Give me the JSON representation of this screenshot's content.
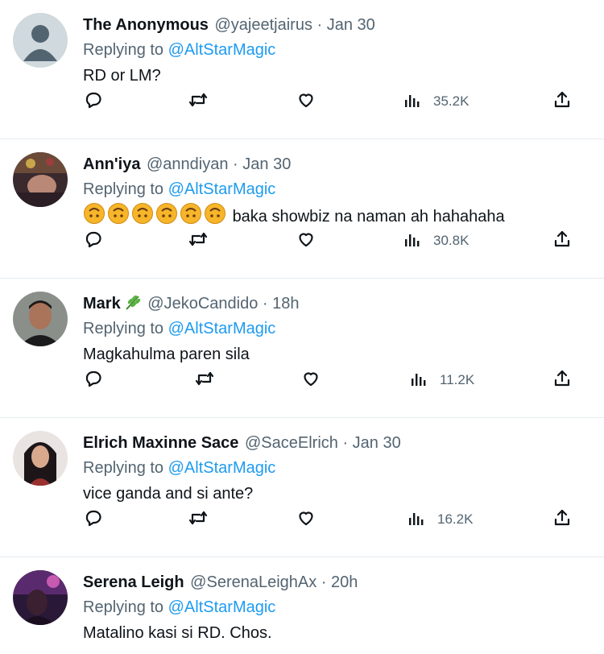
{
  "replying_label": "Replying to",
  "replies": [
    {
      "name": "The Anonymous",
      "handle": "@yajeetjairus",
      "date": "Jan 30",
      "mention": "@AltStarMagic",
      "text": "RD or LM?",
      "views": "35.2K",
      "avatar": "default-silhouette"
    },
    {
      "name": "Ann'iya",
      "handle": "@anndiyan",
      "date": "Jan 30",
      "mention": "@AltStarMagic",
      "emoji_prefix": "🙃🙃🙃🙃🙃🙃",
      "text": "baka showbiz na naman ah hahahaha",
      "views": "30.8K",
      "avatar": "photo"
    },
    {
      "name": "Mark",
      "name_emoji": "🌿",
      "handle": "@JekoCandido",
      "date": "18h",
      "mention": "@AltStarMagic",
      "text": "Magkahulma paren sila",
      "views": "11.2K",
      "avatar": "photo"
    },
    {
      "name": "Elrich Maxinne Sace",
      "handle": "@SaceElrich",
      "date": "Jan 30",
      "mention": "@AltStarMagic",
      "text": "vice ganda and si ante?",
      "views": "16.2K",
      "avatar": "photo"
    },
    {
      "name": "Serena Leigh",
      "handle": "@SerenaLeighAx",
      "date": "20h",
      "mention": "@AltStarMagic",
      "text": "Matalino kasi si RD. Chos.",
      "avatar": "photo"
    }
  ],
  "icons": {
    "reply": "speech-bubble-icon",
    "retweet": "retweet-arrows-icon",
    "like": "heart-icon",
    "views": "bar-chart-icon",
    "share": "share-upload-icon"
  },
  "colors": {
    "text": "#0f1419",
    "secondary": "#536471",
    "link": "#1d9bf0",
    "divider": "#e6ecf0"
  }
}
